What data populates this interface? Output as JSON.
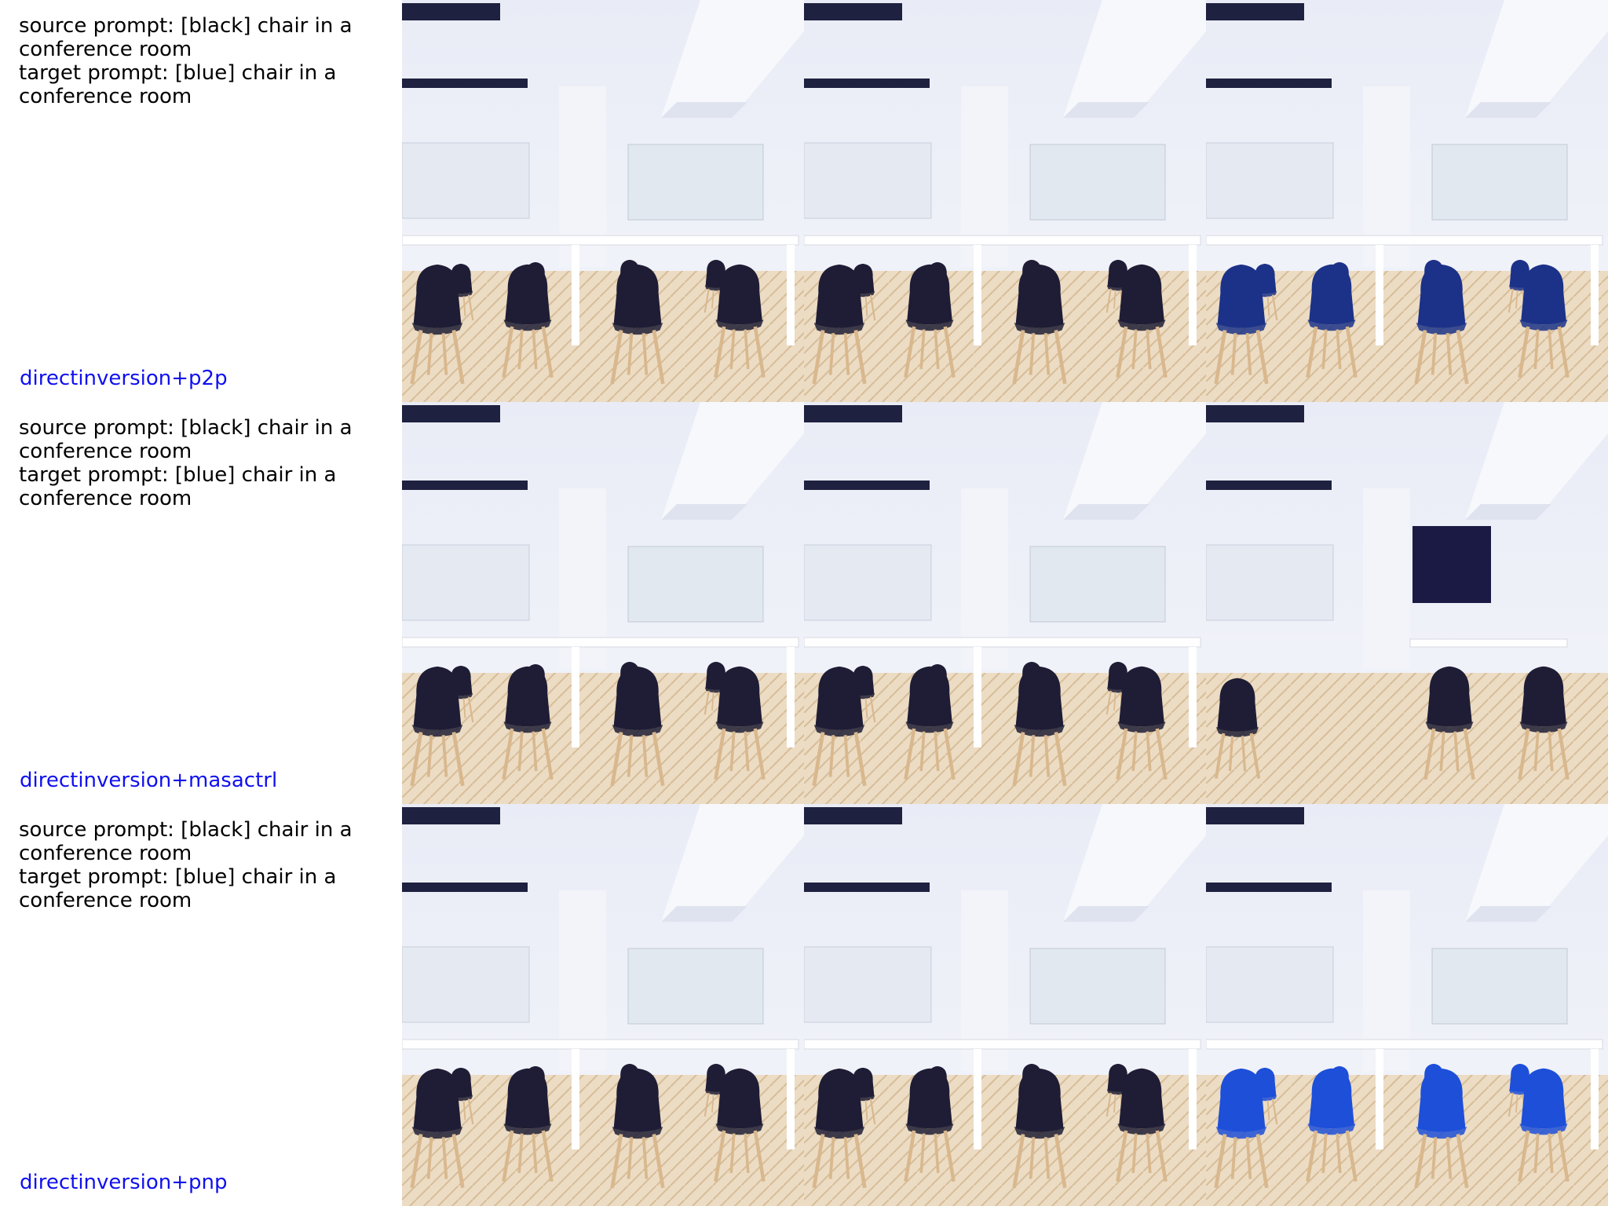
{
  "colors": {
    "method_label": "#1010ee",
    "chair_black": "#1f1d35",
    "chair_blue_dark": "#1c3288",
    "chair_blue_bright": "#1d4fd8"
  },
  "rows": [
    {
      "source_prompt": "source prompt: [black] chair in a conference room",
      "target_prompt": "target prompt: [blue] chair in a conference room",
      "method": "directinversion+p2p"
    },
    {
      "source_prompt": "source prompt: [black] chair in a conference room",
      "target_prompt": "target prompt: [blue] chair in a conference room",
      "method": "directinversion+masactrl"
    },
    {
      "source_prompt": "source prompt: [black] chair in a conference room",
      "target_prompt": "target prompt: [blue] chair in a conference room",
      "method": "directinversion+pnp"
    }
  ]
}
